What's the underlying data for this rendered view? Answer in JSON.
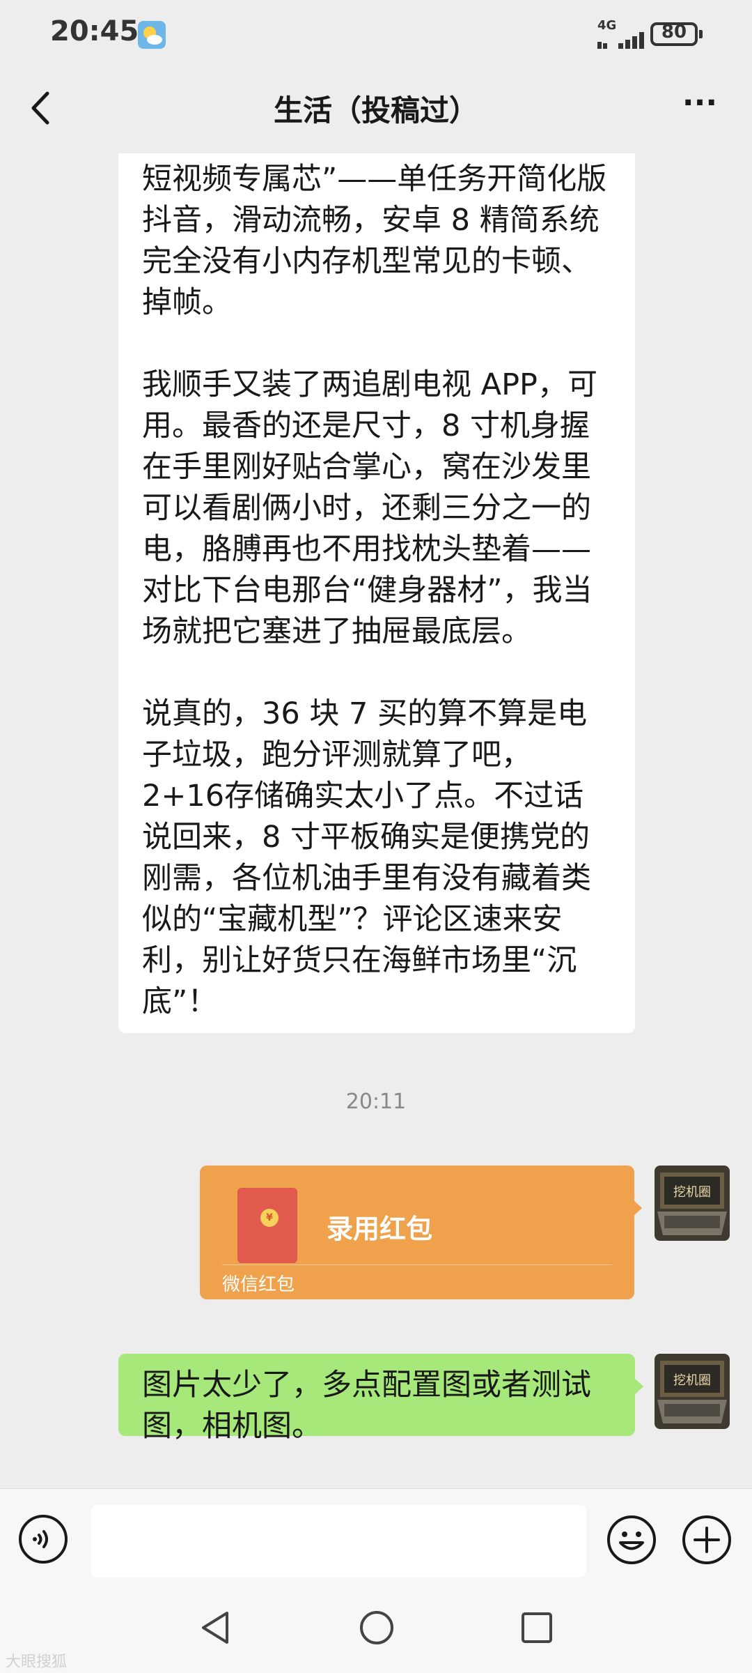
{
  "status_bar": {
    "time": "20:45",
    "network": "4G",
    "battery": "80",
    "weather_icon": "partly-sunny-icon"
  },
  "header": {
    "title": "生活（投稿过）",
    "back_icon": "back-chevron-icon",
    "more_icon": "more-dots-icon",
    "more_label": "···"
  },
  "messages": {
    "received_text": {
      "paragraphs": [
        "短视频专属芯”——单任务开简化版抖音，滑动流畅，安卓 8 精简系统完全没有小内存机型常见的卡顿、掉帧。",
        "我顺手又装了两追剧电视 APP，可用。最香的还是尺寸，8 寸机身握在手里刚好贴合掌心，窝在沙发里可以看剧俩小时，还剩三分之一的电，胳膊再也不用找枕头垫着——对比下台电那台“健身器材”，我当场就把它塞进了抽屉最底层。",
        "说真的，36 块 7 买的算不算是电子垃圾，跑分评测就算了吧，2+16存储确实太小了点。不过话说回来，8 寸平板确实是便携党的刚需，各位机油手里有没有藏着类似的“宝藏机型”？评论区速来安利，别让好货只在海鲜市场里“沉底”！"
      ]
    },
    "timestamp": "20:11",
    "red_packet": {
      "title": "录用红包",
      "label": "微信红包",
      "coin_symbol": "¥"
    },
    "sent_text": "图片太少了，多点配置图或者测试图，相机图。",
    "avatar_label": "挖机圈"
  },
  "input_bar": {
    "placeholder": "",
    "voice_icon": "voice-icon",
    "emoji_icon": "emoji-icon",
    "plus_icon": "plus-icon"
  },
  "system_nav": {
    "back_icon": "nav-back-icon",
    "home_icon": "nav-home-icon",
    "recent_icon": "nav-recent-icon"
  },
  "watermark": "大眼搜狐",
  "colors": {
    "background": "#ededed",
    "received_bubble": "#ffffff",
    "sent_bubble": "#a6e97a",
    "red_packet": "#f0a14c"
  }
}
